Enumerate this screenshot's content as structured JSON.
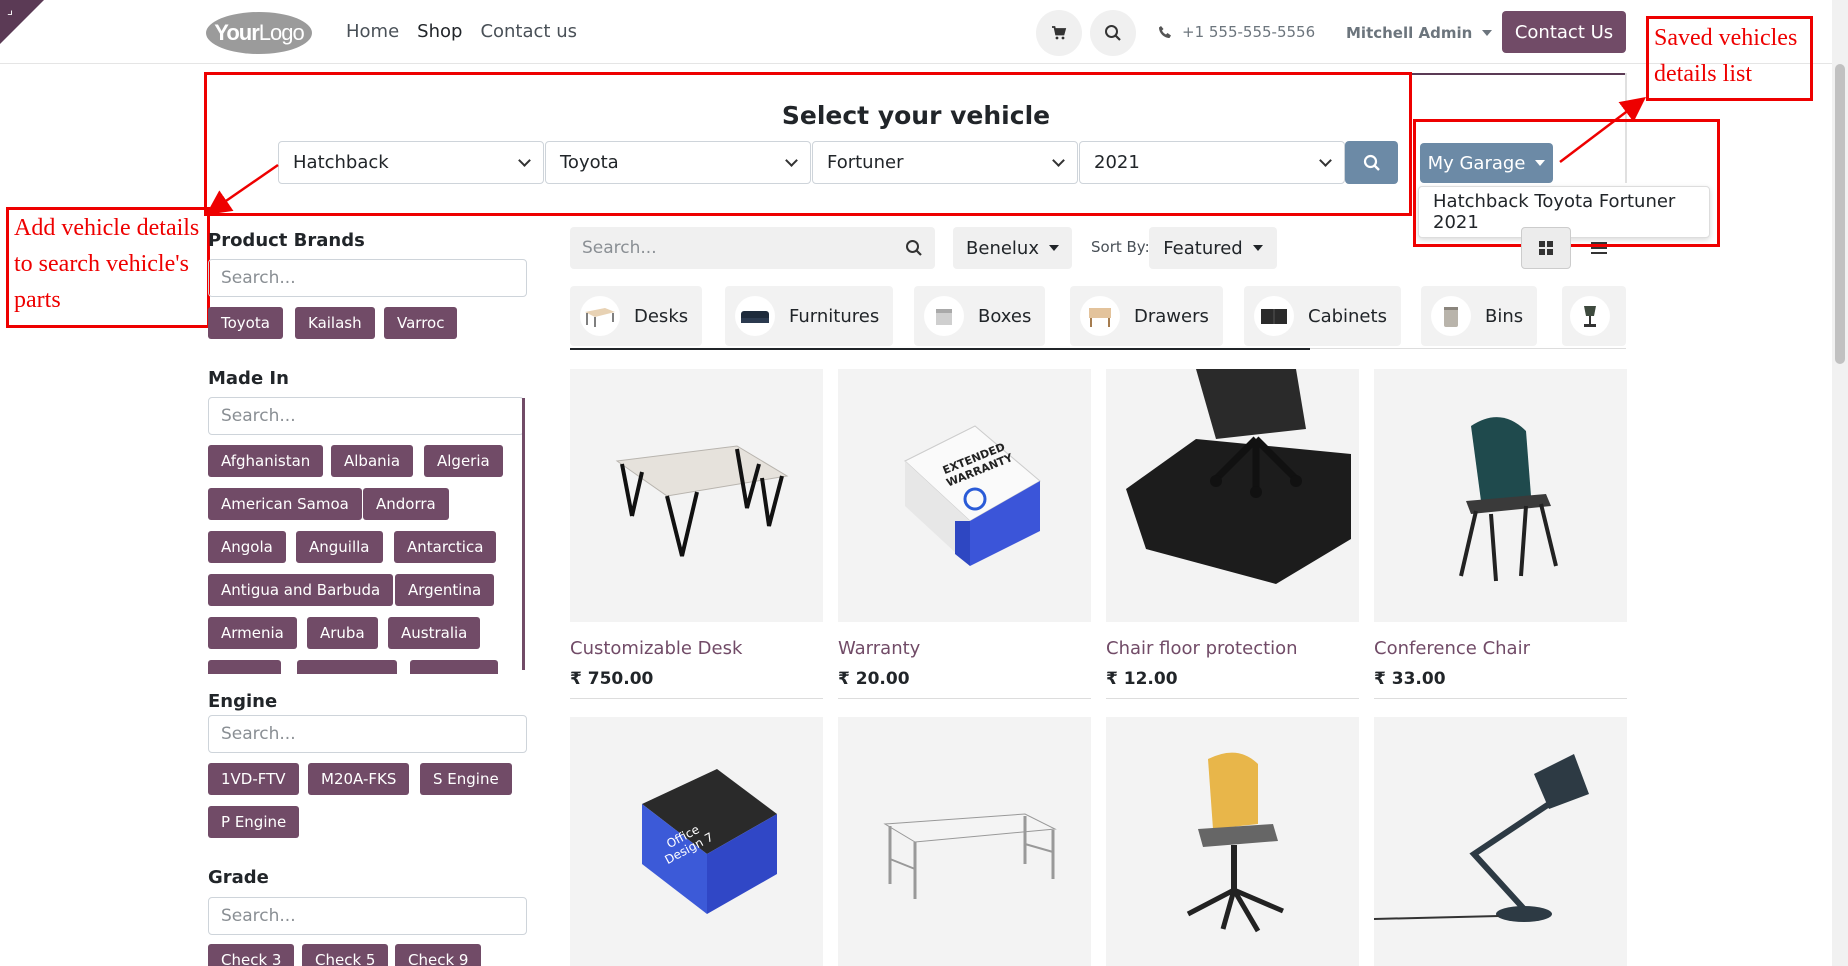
{
  "header": {
    "logo_text_bold": "Your",
    "logo_text_thin": "Logo",
    "nav": [
      "Home",
      "Shop",
      "Contact us"
    ],
    "active_nav": "Shop",
    "phone": "+1 555-555-5556",
    "user": "Mitchell Admin",
    "contact_button": "Contact Us"
  },
  "vehicle": {
    "title": "Select your vehicle",
    "type": "Hatchback",
    "brand": "Toyota",
    "model": "Fortuner",
    "year": "2021",
    "garage_button": "My Garage",
    "garage_items": [
      "Hatchback Toyota Fortuner 2021"
    ]
  },
  "annotations": {
    "left_line1": "Add vehicle details",
    "left_line2": "to search vehicle's",
    "left_line3": "parts",
    "right_line1": "Saved vehicles",
    "right_line2": "details list",
    "color": "#ee0000"
  },
  "filters": {
    "brands": {
      "title": "Product Brands",
      "placeholder": "Search...",
      "tags": [
        "Toyota",
        "Kailash",
        "Varroc"
      ]
    },
    "made_in": {
      "title": "Made In",
      "placeholder": "Search...",
      "tags": [
        "Afghanistan",
        "Albania",
        "Algeria",
        "American Samoa",
        "Andorra",
        "Angola",
        "Anguilla",
        "Antarctica",
        "Antigua and Barbuda",
        "Argentina",
        "Armenia",
        "Aruba",
        "Australia"
      ]
    },
    "engine": {
      "title": "Engine",
      "placeholder": "Search...",
      "tags": [
        "1VD-FTV",
        "M20A-FKS",
        "S Engine",
        "P Engine"
      ]
    },
    "grade": {
      "title": "Grade",
      "placeholder": "Search...",
      "tags": [
        "Check 3",
        "Check 5",
        "Check 9"
      ]
    }
  },
  "toolbar": {
    "search_placeholder": "Search...",
    "pricelist": "Benelux",
    "sort_label": "Sort By:",
    "sort_value": "Featured"
  },
  "categories": [
    "Desks",
    "Furnitures",
    "Boxes",
    "Drawers",
    "Cabinets",
    "Bins"
  ],
  "products": [
    {
      "name": "Customizable Desk",
      "price": "₹ 750.00"
    },
    {
      "name": "Warranty",
      "price": "₹ 20.00"
    },
    {
      "name": "Chair floor protection",
      "price": "₹ 12.00"
    },
    {
      "name": "Conference Chair",
      "price": "₹ 33.00"
    }
  ],
  "colors": {
    "primary": "#714b67",
    "secondary": "#6c8aa6"
  },
  "icons": [
    "cart-icon",
    "search-icon",
    "phone-icon",
    "grid-view-icon",
    "list-view-icon"
  ]
}
